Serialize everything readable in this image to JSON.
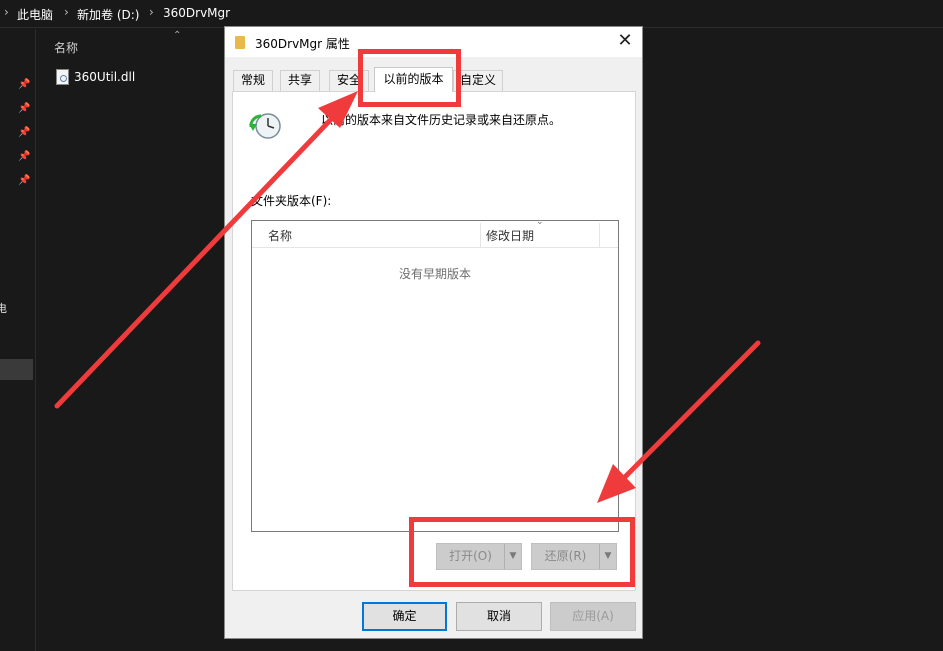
{
  "explorer": {
    "breadcrumb": [
      "此电脑",
      "新加卷 (D:)",
      "360DrvMgr"
    ],
    "column_header": "名称",
    "files": [
      {
        "name": "360Util.dll"
      }
    ],
    "nav_partial_text": "电"
  },
  "dialog": {
    "title": "360DrvMgr 属性",
    "tabs": [
      "常规",
      "共享",
      "安全",
      "以前的版本",
      "自定义"
    ],
    "active_tab": "以前的版本",
    "description": "以前的版本来自文件历史记录或来自还原点。",
    "versions_label": "文件夹版本(F):",
    "list_columns": [
      "名称",
      "修改日期"
    ],
    "empty_message": "没有早期版本",
    "open_button": "打开(O)",
    "restore_button": "还原(R)",
    "ok_button": "确定",
    "cancel_button": "取消",
    "apply_button": "应用(A)"
  },
  "colors": {
    "annotation": "#ef3b3b",
    "primary_border": "#0078d7",
    "explorer_bg": "#191919"
  }
}
